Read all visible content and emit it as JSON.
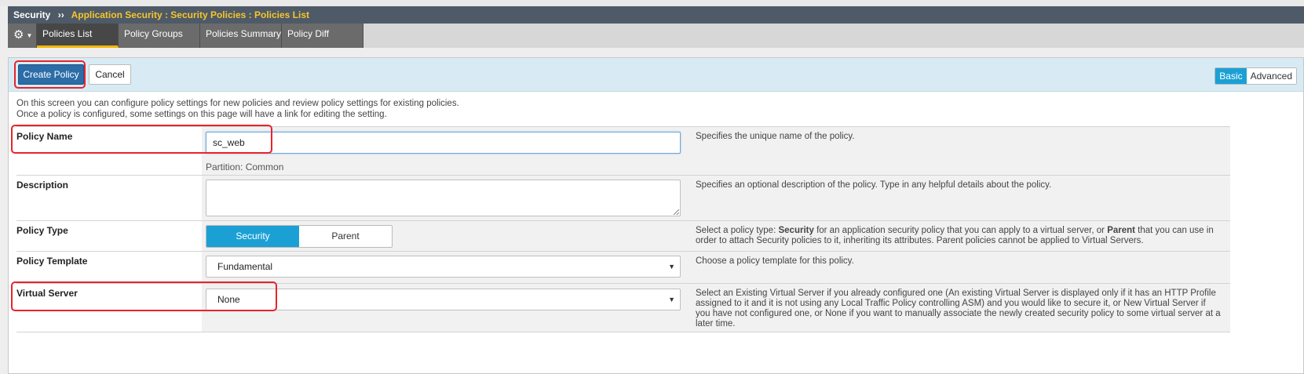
{
  "breadcrumb": {
    "root": "Security",
    "separator": "››",
    "path": "Application Security : Security Policies : Policies List"
  },
  "tabs": {
    "gear_icon": "gear-icon",
    "items": [
      {
        "label": "Policies List",
        "active": true
      },
      {
        "label": "Policy Groups",
        "active": false
      },
      {
        "label": "Policies Summary",
        "active": false
      },
      {
        "label": "Policy Diff",
        "active": false
      }
    ]
  },
  "actions": {
    "create_label": "Create Policy",
    "cancel_label": "Cancel",
    "mode": {
      "basic": "Basic",
      "advanced": "Advanced",
      "selected": "Basic"
    }
  },
  "intro": {
    "line1": "On this screen you can configure policy settings for new policies and review policy settings for existing policies.",
    "line2": "Once a policy is configured, some settings on this page will have a link for editing the setting."
  },
  "form": {
    "policy_name": {
      "label": "Policy Name",
      "value": "sc_web",
      "partition": "Partition: Common",
      "help": "Specifies the unique name of the policy."
    },
    "description": {
      "label": "Description",
      "value": "",
      "help": "Specifies an optional description of the policy. Type in any helpful details about the policy."
    },
    "policy_type": {
      "label": "Policy Type",
      "options": [
        "Security",
        "Parent"
      ],
      "selected": "Security",
      "help_pre": "Select a policy type: ",
      "help_b1": "Security",
      "help_mid": " for an application security policy that you can apply to a virtual server, or ",
      "help_b2": "Parent",
      "help_post": " that you can use in order to attach Security policies to it, inheriting its attributes. Parent policies cannot be applied to Virtual Servers."
    },
    "policy_template": {
      "label": "Policy Template",
      "value": "Fundamental",
      "help": "Choose a policy template for this policy."
    },
    "virtual_server": {
      "label": "Virtual Server",
      "value": "None",
      "help": "Select an Existing Virtual Server if you already configured one (An existing Virtual Server is displayed only if it has an HTTP Profile assigned to it and it is not using any Local Traffic Policy controlling ASM) and you would like to secure it, or New Virtual Server if you have not configured one, or None if you want to manually associate the newly created security policy to some virtual server at a later time."
    }
  },
  "colors": {
    "primary_button": "#2c6da8",
    "toggle_active": "#1ba0d5",
    "highlight": "#e8242b",
    "breadcrumb_path": "#f7c52b"
  }
}
